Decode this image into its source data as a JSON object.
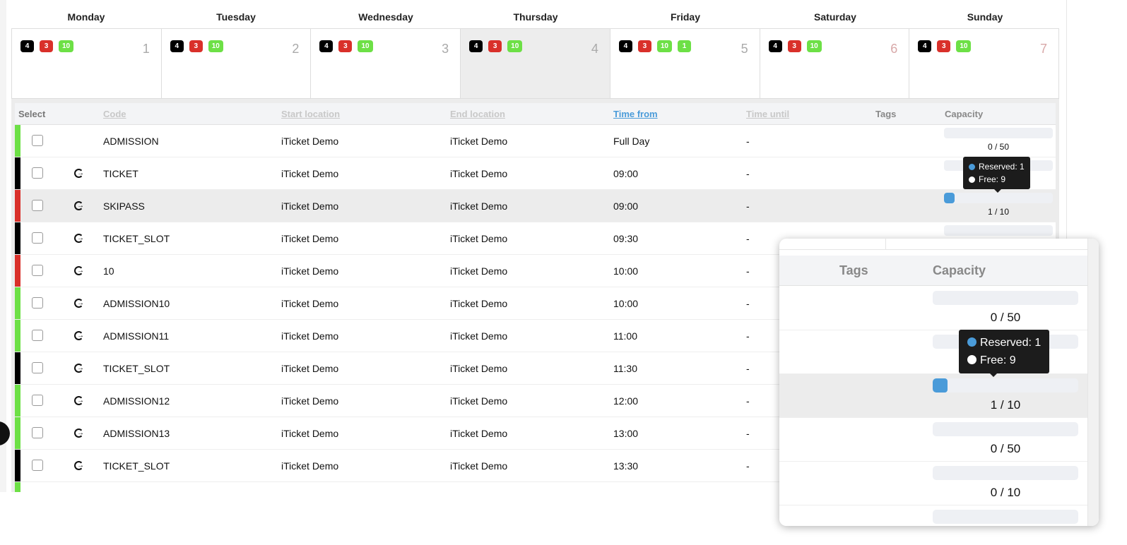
{
  "calendar": {
    "days": [
      {
        "name": "Monday",
        "number": "1",
        "badges": [
          "4",
          "3",
          "10"
        ],
        "today": false,
        "weekend": false
      },
      {
        "name": "Tuesday",
        "number": "2",
        "badges": [
          "4",
          "3",
          "10"
        ],
        "today": false,
        "weekend": false
      },
      {
        "name": "Wednesday",
        "number": "3",
        "badges": [
          "4",
          "3",
          "10"
        ],
        "today": false,
        "weekend": false
      },
      {
        "name": "Thursday",
        "number": "4",
        "badges": [
          "4",
          "3",
          "10"
        ],
        "today": true,
        "weekend": false
      },
      {
        "name": "Friday",
        "number": "5",
        "badges": [
          "4",
          "3",
          "10",
          "1"
        ],
        "today": false,
        "weekend": false
      },
      {
        "name": "Saturday",
        "number": "6",
        "badges": [
          "4",
          "3",
          "10"
        ],
        "today": false,
        "weekend": true
      },
      {
        "name": "Sunday",
        "number": "7",
        "badges": [
          "4",
          "3",
          "10"
        ],
        "today": false,
        "weekend": true
      }
    ],
    "badge_colors": [
      "#000000",
      "#d9302a",
      "#6de046",
      "#6de046"
    ]
  },
  "table": {
    "headers": {
      "select": "Select",
      "code": "Code",
      "start": "Start location",
      "end": "End location",
      "time_from": "Time from",
      "time_until": "Time until",
      "tags": "Tags",
      "capacity": "Capacity"
    },
    "colors": {
      "green": "#6de046",
      "black": "#000000",
      "red": "#d9302a",
      "accent": "#4a9bd9"
    },
    "rows": [
      {
        "color": "green",
        "icon": "",
        "code": "ADMISSION",
        "start": "iTicket Demo",
        "end": "iTicket Demo",
        "from": "Full Day",
        "until": "-",
        "capacity": "0 / 50",
        "fill": 0
      },
      {
        "color": "black",
        "icon": "sign-out-icon",
        "code": "TICKET",
        "start": "iTicket Demo",
        "end": "iTicket Demo",
        "from": "09:00",
        "until": "-",
        "capacity": "",
        "fill": 0
      },
      {
        "color": "red",
        "icon": "sign-out-icon",
        "code": "SKIPASS",
        "start": "iTicket Demo",
        "end": "iTicket Demo",
        "from": "09:00",
        "until": "-",
        "capacity": "1 / 10",
        "fill": 0.1,
        "highlight": true
      },
      {
        "color": "black",
        "icon": "sign-out-icon",
        "code": "TICKET_SLOT",
        "start": "iTicket Demo",
        "end": "iTicket Demo",
        "from": "09:30",
        "until": "-",
        "capacity": "0 / 50",
        "fill": 0
      },
      {
        "color": "red",
        "icon": "sign-out-icon",
        "code": "10",
        "start": "iTicket Demo",
        "end": "iTicket Demo",
        "from": "10:00",
        "until": "-",
        "capacity": "0 / 10",
        "fill": 0
      },
      {
        "color": "green",
        "icon": "sign-out-icon",
        "code": "ADMISSION10",
        "start": "iTicket Demo",
        "end": "iTicket Demo",
        "from": "10:00",
        "until": "-",
        "capacity": "",
        "fill": 0
      },
      {
        "color": "green",
        "icon": "sign-out-icon",
        "code": "ADMISSION11",
        "start": "iTicket Demo",
        "end": "iTicket Demo",
        "from": "11:00",
        "until": "-",
        "capacity": "",
        "fill": 0
      },
      {
        "color": "black",
        "icon": "sign-out-icon",
        "code": "TICKET_SLOT",
        "start": "iTicket Demo",
        "end": "iTicket Demo",
        "from": "11:30",
        "until": "-",
        "capacity": "",
        "fill": 0
      },
      {
        "color": "green",
        "icon": "sign-out-icon",
        "code": "ADMISSION12",
        "start": "iTicket Demo",
        "end": "iTicket Demo",
        "from": "12:00",
        "until": "-",
        "capacity": "",
        "fill": 0
      },
      {
        "color": "green",
        "icon": "sign-out-icon",
        "code": "ADMISSION13",
        "start": "iTicket Demo",
        "end": "iTicket Demo",
        "from": "13:00",
        "until": "-",
        "capacity": "",
        "fill": 0
      },
      {
        "color": "black",
        "icon": "sign-out-icon",
        "code": "TICKET_SLOT",
        "start": "iTicket Demo",
        "end": "iTicket Demo",
        "from": "13:30",
        "until": "-",
        "capacity": "",
        "fill": 0
      },
      {
        "color": "green",
        "icon": "sign-out-icon",
        "code": "",
        "start": "",
        "end": "",
        "from": "",
        "until": "",
        "capacity": "",
        "fill": 0
      }
    ]
  },
  "tooltip": {
    "reserved": "Reserved: 1",
    "free": "Free: 9",
    "reserved_color": "#4a9bd9",
    "free_color": "#ffffff"
  },
  "inset": {
    "headers": {
      "tags": "Tags",
      "capacity": "Capacity"
    },
    "rows": [
      {
        "capacity": "0 / 50",
        "fill": 0
      },
      {
        "capacity": "",
        "fill": 0
      },
      {
        "capacity": "1 / 10",
        "fill": 0.1,
        "highlight": true
      },
      {
        "capacity": "0 / 50",
        "fill": 0
      },
      {
        "capacity": "0 / 10",
        "fill": 0
      },
      {
        "capacity": "",
        "fill": 0
      }
    ]
  }
}
